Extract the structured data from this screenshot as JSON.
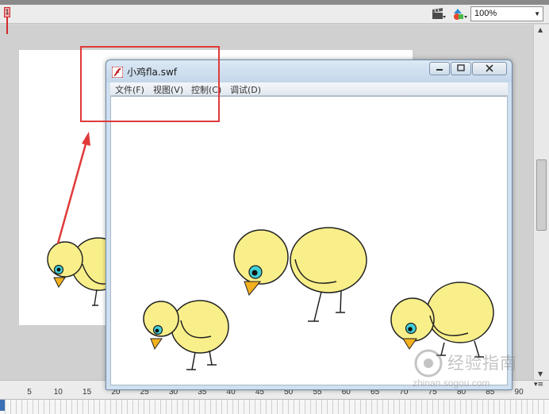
{
  "toolbar": {
    "edit_scene_icon": "clapperboard-icon",
    "edit_symbol_icon": "symbol-shapes-icon",
    "zoom_value": "100%"
  },
  "timeline": {
    "current_frame": "1",
    "frame_labels": [
      "5",
      "10",
      "15",
      "20",
      "25",
      "30",
      "35",
      "40",
      "45",
      "50",
      "55",
      "60",
      "65",
      "70",
      "75",
      "80",
      "85",
      "90"
    ]
  },
  "swf_window": {
    "title": "小鸡fla.swf",
    "menu": {
      "file": "文件(F)",
      "view": "视图(V)",
      "control": "控制(C)",
      "debug": "调试(D)"
    }
  },
  "watermark": {
    "text": "经验指南",
    "url": "zhinan.sogou.com"
  },
  "colors": {
    "chick_fill": "#f9ef8a",
    "beak": "#f2b01e",
    "eye_iris": "#3fd0d6",
    "annotation_red": "#e03a3a"
  }
}
